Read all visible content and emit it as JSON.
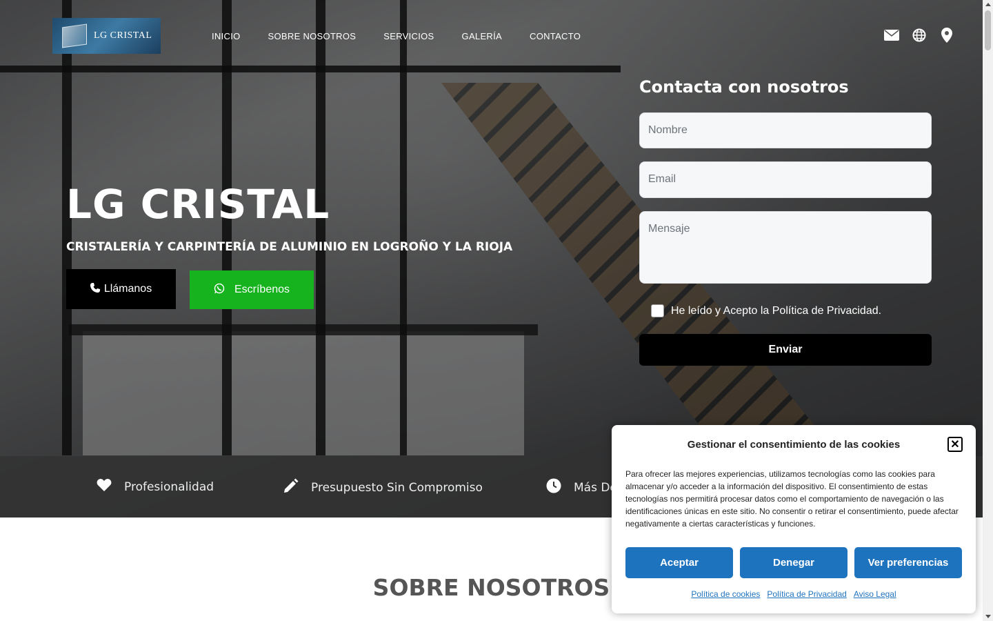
{
  "header": {
    "logo_text": "LG CRISTAL",
    "nav": [
      "INICIO",
      "SOBRE NOSOTROS",
      "SERVICIOS",
      "GALERÍA",
      "CONTACTO"
    ],
    "icons": [
      "envelope-icon",
      "globe-icon",
      "map-pin-icon"
    ]
  },
  "hero": {
    "title": "LG CRISTAL",
    "subtitle": "CRISTALERÍA Y CARPINTERÍA DE ALUMINIO EN LOGROÑO Y LA RIOJA",
    "call_label": "Llámanos",
    "write_label": "Escríbenos"
  },
  "contact_form": {
    "title": "Contacta con nosotros",
    "name_placeholder": "Nombre",
    "email_placeholder": "Email",
    "message_placeholder": "Mensaje",
    "privacy_label": "He leído y Acepto la Política de Privacidad.",
    "submit_label": "Enviar"
  },
  "features": [
    "Profesionalidad",
    "Presupuesto Sin Compromiso",
    "Más De"
  ],
  "about": {
    "title": "SOBRE NOSOTROS"
  },
  "cookie_modal": {
    "title": "Gestionar el consentimiento de las cookies",
    "body": "Para ofrecer las mejores experiencias, utilizamos tecnologías como las cookies para almacenar y/o acceder a la información del dispositivo. El consentimiento de estas tecnologías nos permitirá procesar datos como el comportamiento de navegación o las identificaciones únicas en este sitio. No consentir o retirar el consentimiento, puede afectar negativamente a ciertas características y funciones.",
    "accept_label": "Aceptar",
    "deny_label": "Denegar",
    "prefs_label": "Ver preferencias",
    "links": [
      "Política de cookies",
      "Política de Privacidad",
      "Aviso Legal"
    ]
  },
  "colors": {
    "accent_blue": "#1e73be",
    "whatsapp_green": "#16b31f",
    "black": "#000000"
  }
}
